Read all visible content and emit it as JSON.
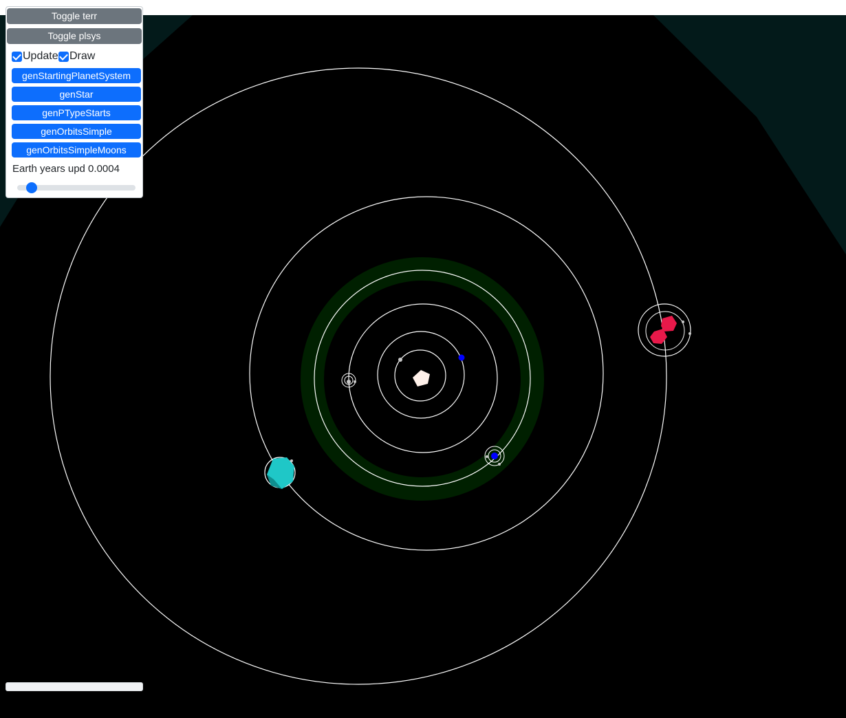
{
  "panel": {
    "toggle_terr_label": "Toggle terr",
    "toggle_plsys_label": "Toggle plsys",
    "update": {
      "label": "Update",
      "checked": true
    },
    "draw": {
      "label": "Draw",
      "checked": true
    },
    "buttons": [
      "genStartingPlanetSystem",
      "genStar",
      "genPTypeStarts",
      "genOrbitsSimple",
      "genOrbitsSimpleMoons"
    ],
    "years_label": "Earth years upd 0.0004",
    "slider_fraction": 0.12
  },
  "colors": {
    "button_secondary": "#6c757d",
    "button_primary": "#0d6efd",
    "space_background": "#031a1a",
    "system_disc": "#000000",
    "habitable_zone": "#002000",
    "orbit_line": "#ffffff",
    "star": "#fff1ea",
    "planet_blue": "#0000ff",
    "planet_cyan": "#1fc7c7",
    "planet_red": "#e8194a",
    "moon": "#c8c8c8"
  },
  "scene": {
    "star_icon": "pentagon",
    "planets": [
      {
        "name": "inner-moon",
        "color": "moon"
      },
      {
        "name": "blue-planet",
        "color": "planet_blue"
      },
      {
        "name": "small-moon-system-planet",
        "color": "moon"
      },
      {
        "name": "blue-planet-with-moons",
        "color": "planet_blue"
      },
      {
        "name": "cyan-planet",
        "color": "planet_cyan"
      },
      {
        "name": "red-double-planet",
        "color": "planet_red"
      }
    ]
  }
}
